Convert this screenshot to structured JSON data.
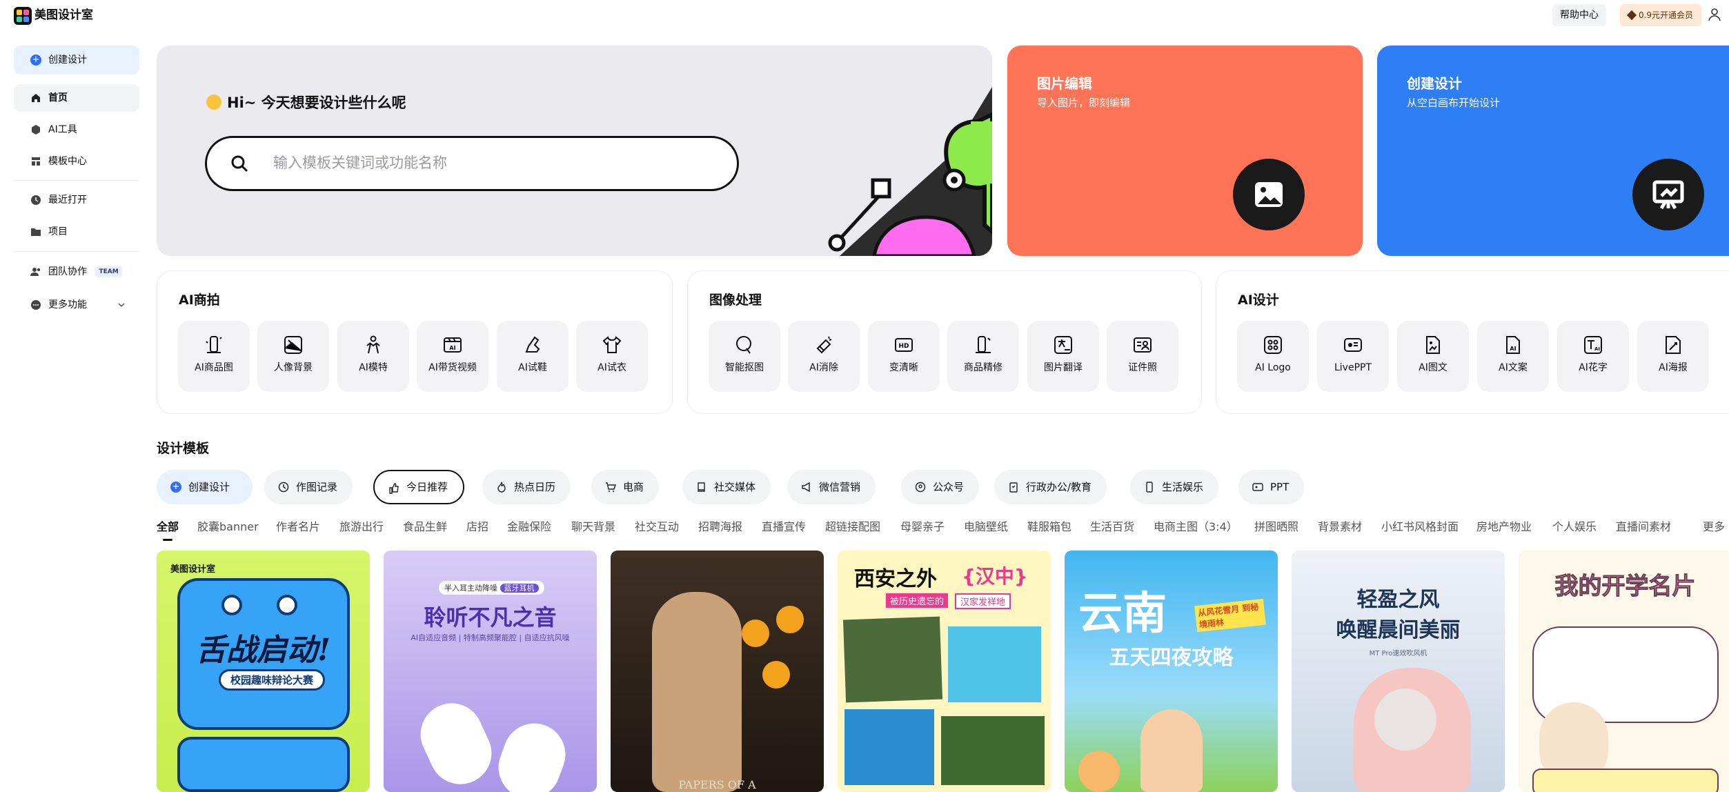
{
  "app": {
    "title": "美图设计室"
  },
  "header": {
    "help": "帮助中心",
    "vip": "0.9元开通会员"
  },
  "sidebar": {
    "create": "创建设计",
    "home": "首页",
    "ai_tools": "AI工具",
    "templates": "模板中心",
    "recent": "最近打开",
    "projects": "项目",
    "team": "团队协作",
    "team_badge": "TEAM",
    "more": "更多功能"
  },
  "hero": {
    "greeting": "Hi~ 今天想要设计些什么呢",
    "search_placeholder": "输入模板关键词或功能名称"
  },
  "cards": {
    "edit": {
      "title": "图片编辑",
      "subtitle": "导入图片，即刻编辑"
    },
    "create": {
      "title": "创建设计",
      "subtitle": "从空白画布开始设计"
    }
  },
  "panels": [
    {
      "title": "AI商拍",
      "tools": [
        "AI商品图",
        "人像背景",
        "AI模特",
        "AI带货视频",
        "AI试鞋",
        "AI试衣"
      ]
    },
    {
      "title": "图像处理",
      "tools": [
        "智能抠图",
        "AI消除",
        "变清晰",
        "商品精修",
        "图片翻译",
        "证件照"
      ]
    },
    {
      "title": "AI设计",
      "tools": [
        "AI Logo",
        "LivePPT",
        "AI图文",
        "AI文案",
        "AI花字",
        "AI海报"
      ]
    }
  ],
  "templates": {
    "title": "设计模板",
    "chips": [
      "创建设计",
      "作图记录",
      "今日推荐",
      "热点日历",
      "电商",
      "社交媒体",
      "微信营销",
      "公众号",
      "行政办公/教育",
      "生活娱乐",
      "PPT"
    ],
    "categories": [
      "全部",
      "胶囊banner",
      "作者名片",
      "旅游出行",
      "食品生鲜",
      "店招",
      "金融保险",
      "聊天背景",
      "社交互动",
      "招聘海报",
      "直播宣传",
      "超链接配图",
      "母婴亲子",
      "电脑壁纸",
      "鞋服箱包",
      "生活百货",
      "电商主图（3:4）",
      "拼图晒照",
      "背景素材",
      "小红书风格封面",
      "房地产物业",
      "个人娱乐",
      "直播间素材",
      "更多"
    ],
    "thumbs": [
      {
        "brand": "美图设计室",
        "title": "舌战启动!",
        "sub": "校园趣味辩论大赛"
      },
      {
        "badge": "半入耳主动降噪",
        "tag": "蓝牙耳机",
        "title": "聆听不凡之音",
        "sub": "AI自适应音频 | 特制高频聚能腔 | 自适应抗风噪"
      },
      {
        "bottom": "PAPERS OF A"
      },
      {
        "title": "西安之外",
        "brace": "{汉中}",
        "sub": "被历史遗忘的",
        "sub2": "汉家发祥地"
      },
      {
        "title": "云南",
        "sub": "五天四夜攻略",
        "tag": "从风花雪月 到秘境雨林"
      },
      {
        "title": "轻盈之风",
        "sub": "唤醒晨间美丽",
        "model": "MT Pro速效吹风机"
      },
      {
        "title": "我的开学名片"
      }
    ]
  },
  "colors": {
    "accent": "#2d6ff4",
    "edit_card": "#ff7357",
    "create_card": "#2e7ef6",
    "vip_bg": "#fde9d6"
  }
}
